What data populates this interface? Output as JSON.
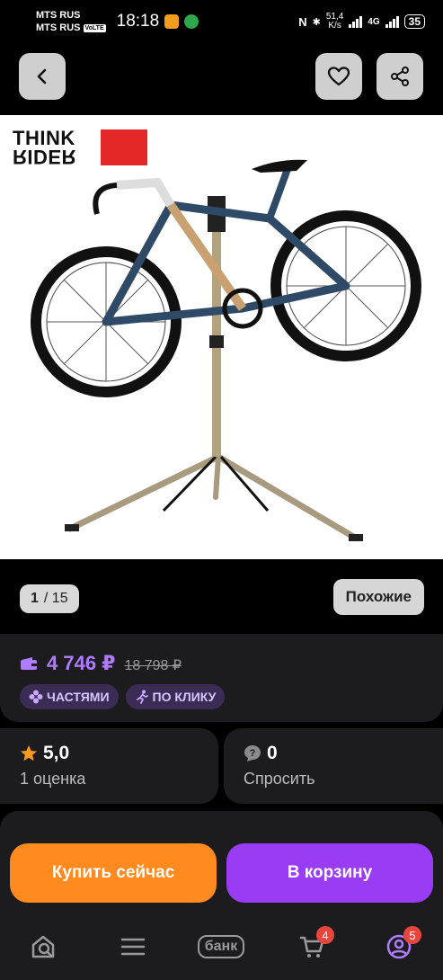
{
  "status": {
    "carrier1": "MTS RUS",
    "carrier2": "MTS RUS",
    "volte": "VoLTE",
    "time": "18:18",
    "net_speed_value": "51,4",
    "net_speed_unit": "K/s",
    "network_type": "4G",
    "battery": "35"
  },
  "gallery": {
    "current": "1",
    "total": "/ 15",
    "similar_label": "Похожие"
  },
  "product_image": {
    "brand_top": "THINK",
    "brand_bottom": "RIDER"
  },
  "price": {
    "current": "4 746 ₽",
    "old": "18 798 ₽",
    "tags": [
      {
        "label": "ЧАСТЯМИ",
        "icon": "installments-icon"
      },
      {
        "label": "ПО КЛИКУ",
        "icon": "running-man-icon"
      }
    ]
  },
  "rating": {
    "value": "5,0",
    "label": "1 оценка"
  },
  "questions": {
    "value": "0",
    "label": "Спросить"
  },
  "actions": {
    "buy_now": "Купить сейчас",
    "add_to_cart": "В корзину"
  },
  "tabbar": {
    "bank_label": "банк",
    "cart_badge": "4",
    "profile_badge": "5"
  },
  "colors": {
    "price": "#b07cff",
    "buy": "#ff8a1f",
    "cart": "#9b3cf5",
    "badge": "#e8453c"
  }
}
